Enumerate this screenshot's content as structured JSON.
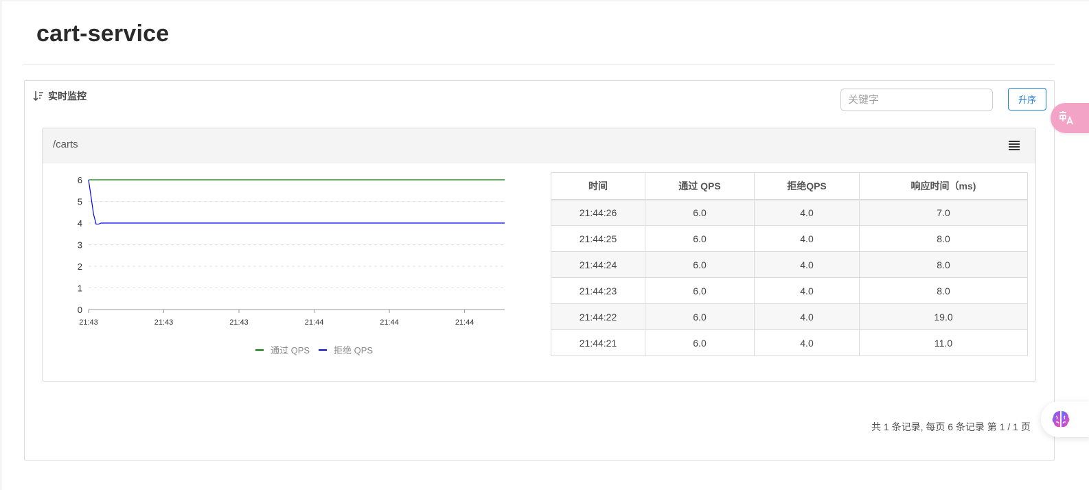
{
  "page": {
    "title": "cart-service"
  },
  "panel": {
    "heading": "实时监控",
    "search": {
      "placeholder": "关键字",
      "value": ""
    },
    "sort_label": "升序"
  },
  "card": {
    "resource": "/carts",
    "table": {
      "headers": [
        "时间",
        "通过 QPS",
        "拒绝QPS",
        "响应时间（ms)"
      ],
      "rows": [
        [
          "21:44:26",
          "6.0",
          "4.0",
          "7.0"
        ],
        [
          "21:44:25",
          "6.0",
          "4.0",
          "8.0"
        ],
        [
          "21:44:24",
          "6.0",
          "4.0",
          "8.0"
        ],
        [
          "21:44:23",
          "6.0",
          "4.0",
          "8.0"
        ],
        [
          "21:44:22",
          "6.0",
          "4.0",
          "19.0"
        ],
        [
          "21:44:21",
          "6.0",
          "4.0",
          "11.0"
        ]
      ]
    }
  },
  "pager": {
    "text": "共 1 条记录, 每页 6 条记录 第 1 / 1 页"
  },
  "colors": {
    "pass": "#008000",
    "block": "#0000ff",
    "accent": "#1e7bd6"
  },
  "icons": [
    "sort-icon",
    "menu-icon",
    "translate-icon",
    "brain-icon"
  ],
  "chart_data": {
    "type": "line",
    "x": [
      0,
      1,
      2,
      3,
      4,
      5,
      6,
      7,
      8,
      9,
      10,
      11,
      12,
      13,
      14,
      15,
      16,
      17,
      18,
      19,
      20,
      21,
      22,
      23,
      24,
      25,
      26,
      27,
      28,
      29,
      30,
      31,
      32,
      33,
      34,
      35,
      36,
      37,
      38,
      39,
      40,
      41,
      42,
      43,
      44,
      45,
      46,
      47,
      48,
      49,
      50,
      51,
      52,
      53,
      54,
      55,
      56,
      57,
      58,
      59,
      60,
      61,
      62,
      63,
      64,
      65,
      66,
      67,
      68,
      69,
      70,
      71,
      72,
      73,
      74,
      75,
      76,
      77,
      78,
      79,
      80,
      81,
      82,
      83,
      84,
      85,
      86,
      87,
      88,
      89,
      90,
      91,
      92,
      93,
      94,
      95,
      96,
      97,
      98,
      99,
      100,
      101,
      102,
      103,
      104,
      105,
      106,
      107,
      108,
      109,
      110,
      111,
      112,
      113,
      114,
      115,
      116,
      117,
      118,
      119,
      120,
      121,
      122,
      123,
      124,
      125,
      126,
      127,
      128,
      129,
      130,
      131,
      132,
      133,
      134,
      135,
      136,
      137,
      138,
      139,
      140,
      141,
      142,
      143,
      144,
      145,
      146,
      147,
      148,
      149,
      150,
      151,
      152,
      153,
      154,
      155,
      156,
      157,
      158,
      159,
      160,
      161,
      162,
      163,
      164,
      165,
      166
    ],
    "x_tick_labels": [
      "21:43",
      "21:43",
      "21:43",
      "21:44",
      "21:44",
      "21:44"
    ],
    "x_tick_positions": [
      0,
      30,
      60,
      90,
      120,
      150
    ],
    "ylim": [
      0,
      6
    ],
    "y_ticks": [
      0,
      1,
      2,
      3,
      4,
      5,
      6
    ],
    "grid": true,
    "legend_position": "bottom",
    "series": [
      {
        "name": "通过 QPS",
        "color": "#008000",
        "values": [
          6,
          6,
          6,
          6,
          6,
          6,
          6,
          6,
          6,
          6,
          6,
          6,
          6,
          6,
          6,
          6,
          6,
          6,
          6,
          6,
          6,
          6,
          6,
          6,
          6,
          6,
          6,
          6,
          6,
          6,
          6,
          6,
          6,
          6,
          6,
          6,
          6,
          6,
          6,
          6,
          6,
          6,
          6,
          6,
          6,
          6,
          6,
          6,
          6,
          6,
          6,
          6,
          6,
          6,
          6,
          6,
          6,
          6,
          6,
          6,
          6,
          6,
          6,
          6,
          6,
          6,
          6,
          6,
          6,
          6,
          6,
          6,
          6,
          6,
          6,
          6,
          6,
          6,
          6,
          6,
          6,
          6,
          6,
          6,
          6,
          6,
          6,
          6,
          6,
          6,
          6,
          6,
          6,
          6,
          6,
          6,
          6,
          6,
          6,
          6,
          6,
          6,
          6,
          6,
          6,
          6,
          6,
          6,
          6,
          6,
          6,
          6,
          6,
          6,
          6,
          6,
          6,
          6,
          6,
          6,
          6,
          6,
          6,
          6,
          6,
          6,
          6,
          6,
          6,
          6,
          6,
          6,
          6,
          6,
          6,
          6,
          6,
          6,
          6,
          6,
          6,
          6,
          6,
          6,
          6,
          6,
          6,
          6,
          6,
          6,
          6,
          6,
          6,
          6,
          6,
          6,
          6,
          6,
          6,
          6,
          6,
          6,
          6,
          6,
          6,
          6,
          6
        ]
      },
      {
        "name": "拒绝 QPS",
        "color": "#0000ff",
        "values": [
          6,
          5.2,
          4.4,
          3.95,
          3.95,
          4,
          4,
          4,
          4,
          4,
          4,
          4,
          4,
          4,
          4,
          4,
          4,
          4,
          4,
          4,
          4,
          4,
          4,
          4,
          4,
          4,
          4,
          4,
          4,
          4,
          4,
          4,
          4,
          4,
          4,
          4,
          4,
          4,
          4,
          4,
          4,
          4,
          4,
          4,
          4,
          4,
          4,
          4,
          4,
          4,
          4,
          4,
          4,
          4,
          4,
          4,
          4,
          4,
          4,
          4,
          4,
          4,
          4,
          4,
          4,
          4,
          4,
          4,
          4,
          4,
          4,
          4,
          4,
          4,
          4,
          4,
          4,
          4,
          4,
          4,
          4,
          4,
          4,
          4,
          4,
          4,
          4,
          4,
          4,
          4,
          4,
          4,
          4,
          4,
          4,
          4,
          4,
          4,
          4,
          4,
          4,
          4,
          4,
          4,
          4,
          4,
          4,
          4,
          4,
          4,
          4,
          4,
          4,
          4,
          4,
          4,
          4,
          4,
          4,
          4,
          4,
          4,
          4,
          4,
          4,
          4,
          4,
          4,
          4,
          4,
          4,
          4,
          4,
          4,
          4,
          4,
          4,
          4,
          4,
          4,
          4,
          4,
          4,
          4,
          4,
          4,
          4,
          4,
          4,
          4,
          4,
          4,
          4,
          4,
          4,
          4,
          4,
          4,
          4,
          4,
          4,
          4,
          4,
          4,
          4,
          4,
          4
        ]
      }
    ]
  }
}
